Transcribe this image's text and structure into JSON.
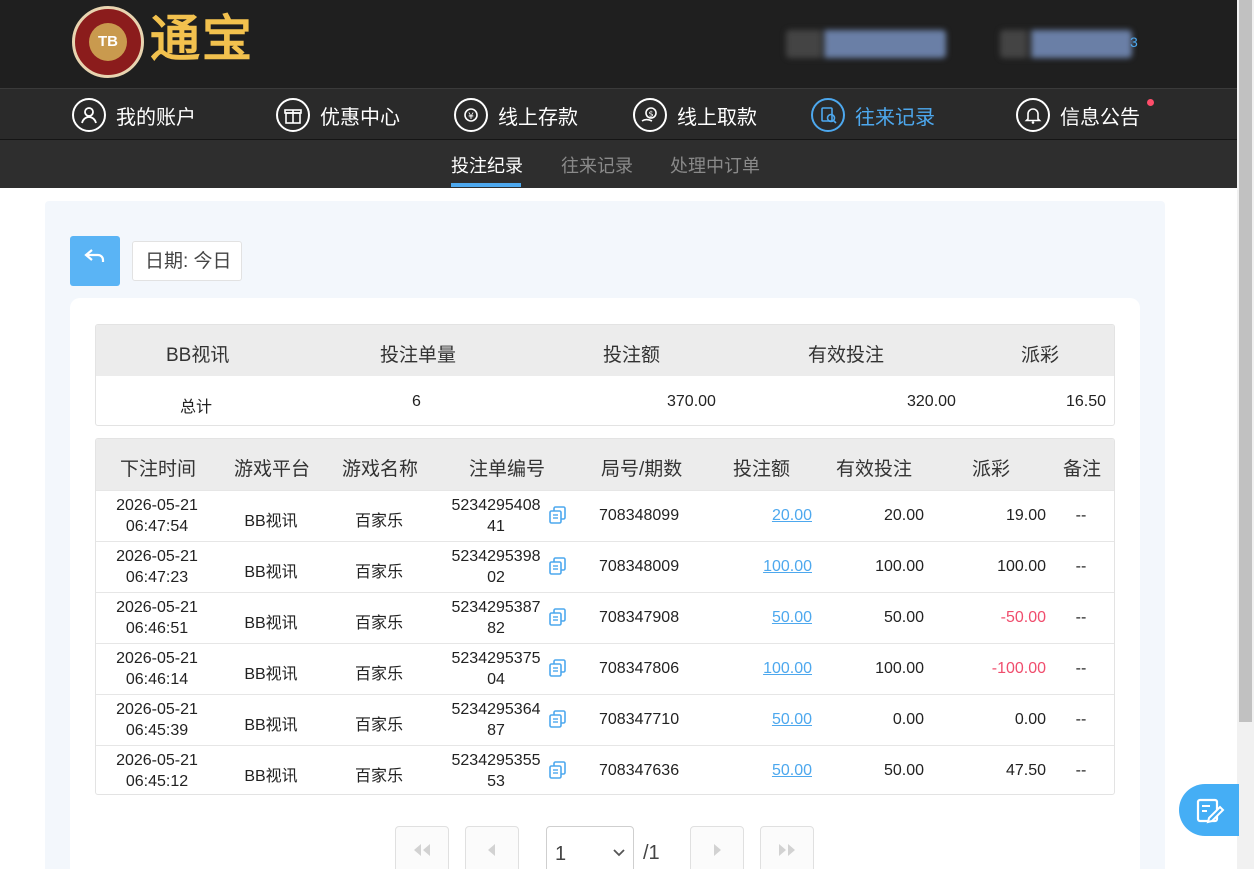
{
  "brand": {
    "logo_badge": "TB",
    "name": "通宝"
  },
  "header": {
    "user_info_tail": "3"
  },
  "nav": [
    {
      "label": "我的账户",
      "icon": "user-icon"
    },
    {
      "label": "优惠中心",
      "icon": "gift-icon"
    },
    {
      "label": "线上存款",
      "icon": "deposit-icon"
    },
    {
      "label": "线上取款",
      "icon": "withdraw-icon"
    },
    {
      "label": "往来记录",
      "icon": "records-icon",
      "active": true
    },
    {
      "label": "信息公告",
      "icon": "bell-icon",
      "has_notification": true
    }
  ],
  "subnav": [
    {
      "label": "投注纪录",
      "active": true
    },
    {
      "label": "往来记录"
    },
    {
      "label": "处理中订单"
    }
  ],
  "filter": {
    "date_label": "日期: 今日"
  },
  "summary": {
    "headers": [
      "BB视讯",
      "投注单量",
      "投注额",
      "有效投注",
      "派彩"
    ],
    "total_label": "总计",
    "count": "6",
    "bet": "370.00",
    "valid": "320.00",
    "payout": "16.50"
  },
  "table": {
    "headers": [
      "下注时间",
      "游戏平台",
      "游戏名称",
      "注单编号",
      "局号/期数",
      "投注额",
      "有效投注",
      "派彩",
      "备注"
    ],
    "rows": [
      {
        "date": "2026-05-21",
        "time": "06:47:54",
        "platform": "BB视讯",
        "game": "百家乐",
        "ticket_a": "5234295408",
        "ticket_b": "41",
        "round": "708348099",
        "bet": "20.00",
        "valid": "20.00",
        "payout": "19.00",
        "note": "--"
      },
      {
        "date": "2026-05-21",
        "time": "06:47:23",
        "platform": "BB视讯",
        "game": "百家乐",
        "ticket_a": "5234295398",
        "ticket_b": "02",
        "round": "708348009",
        "bet": "100.00",
        "valid": "100.00",
        "payout": "100.00",
        "note": "--"
      },
      {
        "date": "2026-05-21",
        "time": "06:46:51",
        "platform": "BB视讯",
        "game": "百家乐",
        "ticket_a": "5234295387",
        "ticket_b": "82",
        "round": "708347908",
        "bet": "50.00",
        "valid": "50.00",
        "payout": "-50.00",
        "note": "--"
      },
      {
        "date": "2026-05-21",
        "time": "06:46:14",
        "platform": "BB视讯",
        "game": "百家乐",
        "ticket_a": "5234295375",
        "ticket_b": "04",
        "round": "708347806",
        "bet": "100.00",
        "valid": "100.00",
        "payout": "-100.00",
        "note": "--"
      },
      {
        "date": "2026-05-21",
        "time": "06:45:39",
        "platform": "BB视讯",
        "game": "百家乐",
        "ticket_a": "5234295364",
        "ticket_b": "87",
        "round": "708347710",
        "bet": "50.00",
        "valid": "0.00",
        "payout": "0.00",
        "note": "--"
      },
      {
        "date": "2026-05-21",
        "time": "06:45:12",
        "platform": "BB视讯",
        "game": "百家乐",
        "ticket_a": "5234295355",
        "ticket_b": "53",
        "round": "708347636",
        "bet": "50.00",
        "valid": "50.00",
        "payout": "47.50",
        "note": "--"
      }
    ]
  },
  "pagination": {
    "current": "1",
    "total": "/1"
  },
  "colors": {
    "accent": "#4da8ee",
    "negative": "#f04d6d",
    "header_bg": "#1f1f1f",
    "brand_gold": "#f2c14e"
  }
}
